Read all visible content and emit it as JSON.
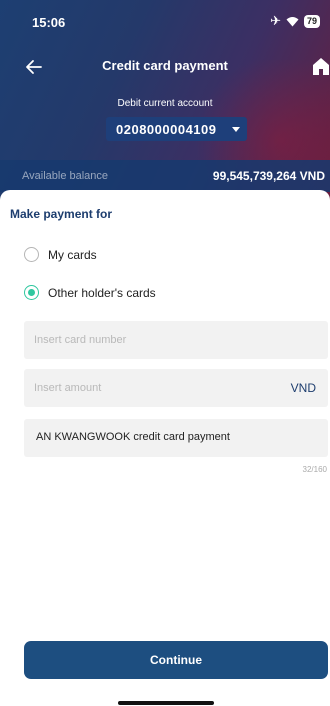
{
  "status_bar": {
    "time": "15:06",
    "battery": "79"
  },
  "header": {
    "title": "Credit card payment"
  },
  "account": {
    "label": "Debit current account",
    "number": "0208000004109"
  },
  "balance": {
    "label": "Available balance",
    "value": "99,545,739,264 VND"
  },
  "form": {
    "section_title": "Make payment for",
    "options": [
      {
        "label": "My cards",
        "selected": false
      },
      {
        "label": "Other holder's cards",
        "selected": true
      }
    ],
    "card_number": {
      "placeholder": "Insert card number",
      "value": ""
    },
    "amount": {
      "placeholder": "Insert amount",
      "value": "",
      "currency": "VND"
    },
    "description": {
      "value": "AN KWANGWOOK credit card payment",
      "counter": "32/160"
    }
  },
  "actions": {
    "continue_label": "Continue"
  },
  "colors": {
    "accent": "#2fc79f",
    "primary": "#1d4e80",
    "title": "#1d3d6e"
  }
}
